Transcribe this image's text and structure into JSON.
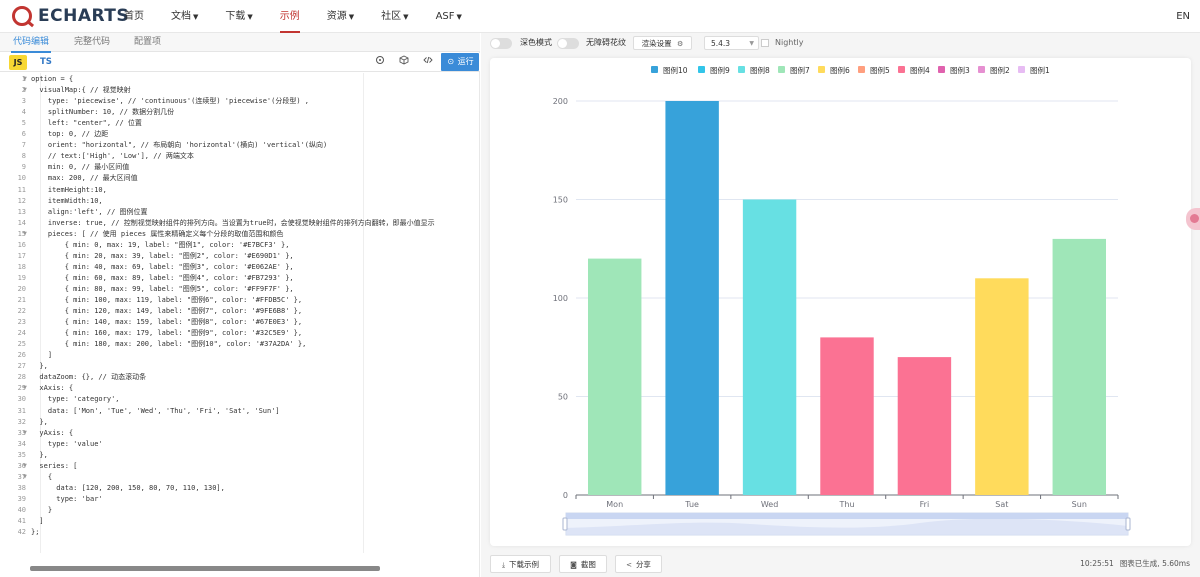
{
  "nav": {
    "logo_text": "ECHARTS",
    "items": [
      {
        "label": "首页",
        "caret": false
      },
      {
        "label": "文档",
        "caret": true
      },
      {
        "label": "下载",
        "caret": true
      },
      {
        "label": "示例",
        "caret": false,
        "active": true
      },
      {
        "label": "资源",
        "caret": true
      },
      {
        "label": "社区",
        "caret": true
      },
      {
        "label": "ASF",
        "caret": true
      }
    ],
    "lang": "EN"
  },
  "editor": {
    "tabs": [
      "代码编辑",
      "完整代码",
      "配置项"
    ],
    "lang_js": "JS",
    "lang_ts": "TS",
    "run_label": "运行",
    "code_lines": [
      {
        "n": "1",
        "fold": true,
        "text": "option = {"
      },
      {
        "n": "2",
        "fold": true,
        "text": "  visualMap:{ // 视觉映射"
      },
      {
        "n": "3",
        "fold": false,
        "text": "    type: 'piecewise', // 'continuous'(连续型) 'piecewise'(分段型) ,"
      },
      {
        "n": "4",
        "fold": false,
        "text": "    splitNumber: 10, // 数据分割几份"
      },
      {
        "n": "5",
        "fold": false,
        "text": "    left: \"center\", // 位置"
      },
      {
        "n": "6",
        "fold": false,
        "text": "    top: 0, // 边距"
      },
      {
        "n": "7",
        "fold": false,
        "text": "    orient: \"horizontal\", // 布局朝向 'horizontal'(横向) 'vertical'(纵向)"
      },
      {
        "n": "8",
        "fold": false,
        "text": "    // text:['High', 'Low'], // 两端文本"
      },
      {
        "n": "9",
        "fold": false,
        "text": "    min: 0, // 最小区间值"
      },
      {
        "n": "10",
        "fold": false,
        "text": "    max: 200, // 最大区间值"
      },
      {
        "n": "11",
        "fold": false,
        "text": "    itemHeight:10,"
      },
      {
        "n": "12",
        "fold": false,
        "text": "    itemWidth:10,"
      },
      {
        "n": "13",
        "fold": false,
        "text": "    align:'left', // 图例位置"
      },
      {
        "n": "14",
        "fold": false,
        "text": "    inverse: true, // 控制视觉映射组件的排列方向。当设置为true时，会使视觉映射组件的排列方向翻转，即最小值显示"
      },
      {
        "n": "15",
        "fold": true,
        "text": "    pieces: [ // 使用 pieces 属性来精确定义每个分段的取值范围和颜色"
      },
      {
        "n": "16",
        "fold": false,
        "text": "        { min: 0, max: 19, label: \"图例1\", color: '#E7BCF3' },"
      },
      {
        "n": "17",
        "fold": false,
        "text": "        { min: 20, max: 39, label: \"图例2\", color: '#E690D1' },"
      },
      {
        "n": "18",
        "fold": false,
        "text": "        { min: 40, max: 69, label: \"图例3\", color: '#E062AE' },"
      },
      {
        "n": "19",
        "fold": false,
        "text": "        { min: 60, max: 89, label: \"图例4\", color: '#FB7293' },"
      },
      {
        "n": "20",
        "fold": false,
        "text": "        { min: 80, max: 99, label: \"图例5\", color: '#FF9F7F' },"
      },
      {
        "n": "21",
        "fold": false,
        "text": "        { min: 100, max: 119, label: \"图例6\", color: '#FFDB5C' },"
      },
      {
        "n": "22",
        "fold": false,
        "text": "        { min: 120, max: 149, label: \"图例7\", color: '#9FE6B8' },"
      },
      {
        "n": "23",
        "fold": false,
        "text": "        { min: 140, max: 159, label: \"图例8\", color: '#67E0E3' },"
      },
      {
        "n": "24",
        "fold": false,
        "text": "        { min: 160, max: 179, label: \"图例9\", color: '#32C5E9' },"
      },
      {
        "n": "25",
        "fold": false,
        "text": "        { min: 180, max: 200, label: \"图例10\", color: '#37A2DA' },"
      },
      {
        "n": "26",
        "fold": false,
        "text": "    ]"
      },
      {
        "n": "27",
        "fold": false,
        "text": "  },"
      },
      {
        "n": "28",
        "fold": false,
        "text": "  dataZoom: {}, // 动态滚动条"
      },
      {
        "n": "29",
        "fold": true,
        "text": "  xAxis: {"
      },
      {
        "n": "30",
        "fold": false,
        "text": "    type: 'category',"
      },
      {
        "n": "31",
        "fold": false,
        "text": "    data: ['Mon', 'Tue', 'Wed', 'Thu', 'Fri', 'Sat', 'Sun']"
      },
      {
        "n": "32",
        "fold": false,
        "text": "  },"
      },
      {
        "n": "33",
        "fold": true,
        "text": "  yAxis: {"
      },
      {
        "n": "34",
        "fold": false,
        "text": "    type: 'value'"
      },
      {
        "n": "35",
        "fold": false,
        "text": "  },"
      },
      {
        "n": "36",
        "fold": true,
        "text": "  series: ["
      },
      {
        "n": "37",
        "fold": true,
        "text": "    {"
      },
      {
        "n": "38",
        "fold": false,
        "text": "      data: [120, 200, 150, 80, 70, 110, 130],"
      },
      {
        "n": "39",
        "fold": false,
        "text": "      type: 'bar'"
      },
      {
        "n": "40",
        "fold": false,
        "text": "    }"
      },
      {
        "n": "41",
        "fold": false,
        "text": "  ]"
      },
      {
        "n": "42",
        "fold": false,
        "text": "};"
      }
    ]
  },
  "controls": {
    "dark_mode_label": "深色模式",
    "no_decal_label": "无障碍花纹",
    "render_settings_label": "渲染设置",
    "version": "5.4.3",
    "nightly_label": "Nightly"
  },
  "bottom": {
    "download_label": "下载示例",
    "screenshot_label": "截图",
    "share_label": "分享",
    "time": "10:25:51",
    "status": "图表已生成, 5.60ms"
  },
  "chart_data": {
    "type": "bar",
    "categories": [
      "Mon",
      "Tue",
      "Wed",
      "Thu",
      "Fri",
      "Sat",
      "Sun"
    ],
    "values": [
      120,
      200,
      150,
      80,
      70,
      110,
      130
    ],
    "bar_colors": [
      "#9FE6B8",
      "#37A2DA",
      "#67E0E3",
      "#FB7293",
      "#FB7293",
      "#FFDB5C",
      "#9FE6B8"
    ],
    "ylim": [
      0,
      200
    ],
    "y_ticks": [
      0,
      50,
      100,
      150,
      200
    ],
    "legend": [
      {
        "label": "图例10",
        "color": "#37A2DA"
      },
      {
        "label": "图例9",
        "color": "#32C5E9"
      },
      {
        "label": "图例8",
        "color": "#67E0E3"
      },
      {
        "label": "图例7",
        "color": "#9FE6B8"
      },
      {
        "label": "图例6",
        "color": "#FFDB5C"
      },
      {
        "label": "图例5",
        "color": "#FF9F7F"
      },
      {
        "label": "图例4",
        "color": "#FB7293"
      },
      {
        "label": "图例3",
        "color": "#E062AE"
      },
      {
        "label": "图例2",
        "color": "#E690D1"
      },
      {
        "label": "图例1",
        "color": "#E7BCF3"
      }
    ],
    "legend_position": "top-center",
    "grid": true,
    "data_zoom": true
  }
}
